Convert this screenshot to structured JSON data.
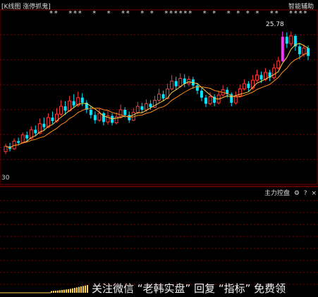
{
  "header": {
    "left_title": "[K线图  涨停抓鬼]",
    "right_label": "智能辅助"
  },
  "indicator_panel": {
    "label": "主力控盘",
    "icons": [
      "gear-icon",
      "question-icon",
      "close-icon"
    ]
  },
  "watermark": "关注微信 “老韩实盘” 回复 “指标” 免费领",
  "colors": {
    "up": "#ff3b3b",
    "down": "#00e5ff",
    "limit_up": "#ff33ff",
    "ma_short": "#ffd24a",
    "ma_long": "#ff8c1a",
    "grid": "#7a0000",
    "star": "#e6e6e6",
    "bar_volume": "#ffd24a"
  },
  "chart_data": {
    "type": "candlestick",
    "price_low_label": "30",
    "peak_label": "25.78",
    "ylim": [
      10,
      27
    ],
    "candles": [
      {
        "o": 12.0,
        "c": 12.6,
        "h": 12.9,
        "l": 11.7
      },
      {
        "o": 12.6,
        "c": 12.3,
        "h": 13.0,
        "l": 12.0
      },
      {
        "o": 12.3,
        "c": 13.2,
        "h": 13.5,
        "l": 12.2
      },
      {
        "o": 13.2,
        "c": 13.0,
        "h": 13.6,
        "l": 12.7
      },
      {
        "o": 13.0,
        "c": 13.9,
        "h": 14.2,
        "l": 12.9
      },
      {
        "o": 13.9,
        "c": 13.5,
        "h": 14.3,
        "l": 13.2
      },
      {
        "o": 13.5,
        "c": 14.5,
        "h": 14.9,
        "l": 13.4
      },
      {
        "o": 14.5,
        "c": 14.1,
        "h": 15.0,
        "l": 13.8
      },
      {
        "o": 14.1,
        "c": 15.2,
        "h": 15.8,
        "l": 14.0
      },
      {
        "o": 15.2,
        "c": 14.8,
        "h": 15.9,
        "l": 14.5
      },
      {
        "o": 14.8,
        "c": 15.9,
        "h": 16.4,
        "l": 14.7
      },
      {
        "o": 15.9,
        "c": 15.5,
        "h": 16.6,
        "l": 15.2
      },
      {
        "o": 15.5,
        "c": 16.3,
        "h": 17.0,
        "l": 15.3
      },
      {
        "o": 16.3,
        "c": 17.2,
        "h": 17.9,
        "l": 16.1
      },
      {
        "o": 17.2,
        "c": 16.7,
        "h": 17.8,
        "l": 16.2
      },
      {
        "o": 16.7,
        "c": 17.8,
        "h": 18.4,
        "l": 16.6
      },
      {
        "o": 17.8,
        "c": 17.3,
        "h": 18.6,
        "l": 17.0
      },
      {
        "o": 17.3,
        "c": 18.2,
        "h": 18.9,
        "l": 17.1
      },
      {
        "o": 18.2,
        "c": 17.6,
        "h": 18.7,
        "l": 17.2
      },
      {
        "o": 17.6,
        "c": 16.8,
        "h": 17.9,
        "l": 16.4
      },
      {
        "o": 16.8,
        "c": 16.2,
        "h": 17.2,
        "l": 15.8
      },
      {
        "o": 16.2,
        "c": 15.6,
        "h": 16.6,
        "l": 15.2
      },
      {
        "o": 15.6,
        "c": 16.4,
        "h": 16.9,
        "l": 15.4
      },
      {
        "o": 16.4,
        "c": 15.4,
        "h": 16.6,
        "l": 15.0
      },
      {
        "o": 15.4,
        "c": 16.1,
        "h": 16.7,
        "l": 15.1
      },
      {
        "o": 16.1,
        "c": 15.3,
        "h": 16.4,
        "l": 15.0
      },
      {
        "o": 15.3,
        "c": 16.0,
        "h": 16.5,
        "l": 15.1
      },
      {
        "o": 16.0,
        "c": 16.8,
        "h": 17.4,
        "l": 15.8
      },
      {
        "o": 16.8,
        "c": 16.2,
        "h": 17.1,
        "l": 15.9
      },
      {
        "o": 16.2,
        "c": 15.6,
        "h": 16.6,
        "l": 15.3
      },
      {
        "o": 15.6,
        "c": 16.5,
        "h": 17.0,
        "l": 15.5
      },
      {
        "o": 16.5,
        "c": 17.2,
        "h": 17.7,
        "l": 16.3
      },
      {
        "o": 17.2,
        "c": 16.8,
        "h": 17.6,
        "l": 16.4
      },
      {
        "o": 16.8,
        "c": 17.5,
        "h": 18.0,
        "l": 16.6
      },
      {
        "o": 17.5,
        "c": 17.1,
        "h": 17.9,
        "l": 16.8
      },
      {
        "o": 17.1,
        "c": 17.9,
        "h": 18.4,
        "l": 17.0
      },
      {
        "o": 17.9,
        "c": 18.6,
        "h": 19.2,
        "l": 17.7
      },
      {
        "o": 18.6,
        "c": 18.1,
        "h": 19.0,
        "l": 17.8
      },
      {
        "o": 18.1,
        "c": 19.2,
        "h": 19.8,
        "l": 18.0
      },
      {
        "o": 19.2,
        "c": 20.1,
        "h": 20.8,
        "l": 19.0
      },
      {
        "o": 20.1,
        "c": 19.5,
        "h": 20.6,
        "l": 19.1
      },
      {
        "o": 19.5,
        "c": 20.4,
        "h": 21.0,
        "l": 19.3
      },
      {
        "o": 20.4,
        "c": 19.8,
        "h": 20.9,
        "l": 19.4
      },
      {
        "o": 19.8,
        "c": 20.3,
        "h": 20.7,
        "l": 19.5
      },
      {
        "o": 20.3,
        "c": 19.6,
        "h": 20.6,
        "l": 19.2
      },
      {
        "o": 19.6,
        "c": 19.0,
        "h": 19.9,
        "l": 18.6
      },
      {
        "o": 19.0,
        "c": 18.2,
        "h": 19.3,
        "l": 17.8
      },
      {
        "o": 18.2,
        "c": 17.5,
        "h": 18.5,
        "l": 17.1
      },
      {
        "o": 17.5,
        "c": 18.3,
        "h": 18.8,
        "l": 17.3
      },
      {
        "o": 18.3,
        "c": 17.6,
        "h": 18.6,
        "l": 17.2
      },
      {
        "o": 17.6,
        "c": 18.5,
        "h": 19.0,
        "l": 17.4
      },
      {
        "o": 18.5,
        "c": 19.1,
        "h": 19.6,
        "l": 18.3
      },
      {
        "o": 19.1,
        "c": 18.6,
        "h": 19.4,
        "l": 18.2
      },
      {
        "o": 18.6,
        "c": 17.6,
        "h": 18.8,
        "l": 17.2
      },
      {
        "o": 17.6,
        "c": 18.4,
        "h": 18.9,
        "l": 17.4
      },
      {
        "o": 18.4,
        "c": 19.2,
        "h": 19.7,
        "l": 18.2
      },
      {
        "o": 19.2,
        "c": 19.8,
        "h": 20.3,
        "l": 19.0
      },
      {
        "o": 19.8,
        "c": 19.3,
        "h": 20.1,
        "l": 18.9
      },
      {
        "o": 19.3,
        "c": 20.2,
        "h": 20.8,
        "l": 19.1
      },
      {
        "o": 20.2,
        "c": 20.8,
        "h": 21.4,
        "l": 20.0
      },
      {
        "o": 20.8,
        "c": 20.3,
        "h": 21.2,
        "l": 19.9
      },
      {
        "o": 20.3,
        "c": 21.1,
        "h": 21.6,
        "l": 20.1
      },
      {
        "o": 21.1,
        "c": 20.5,
        "h": 21.4,
        "l": 20.1
      },
      {
        "o": 20.5,
        "c": 21.6,
        "h": 22.1,
        "l": 20.3
      },
      {
        "o": 21.6,
        "c": 22.4,
        "h": 22.9,
        "l": 21.4
      },
      {
        "o": 22.4,
        "c": 25.2,
        "h": 25.8,
        "l": 22.3
      },
      {
        "o": 25.2,
        "c": 24.4,
        "h": 25.7,
        "l": 23.9
      },
      {
        "o": 24.4,
        "c": 25.3,
        "h": 25.8,
        "l": 24.1
      },
      {
        "o": 25.3,
        "c": 24.1,
        "h": 25.5,
        "l": 23.6
      },
      {
        "o": 24.1,
        "c": 23.2,
        "h": 24.4,
        "l": 22.6
      },
      {
        "o": 23.2,
        "c": 23.9,
        "h": 24.3,
        "l": 22.9
      },
      {
        "o": 23.9,
        "c": 23.0,
        "h": 24.2,
        "l": 22.5
      }
    ],
    "limit_up_index": 65,
    "star_rows": "**  ***  *  *  **  * *  ******  * *  * * * *  **  ****",
    "volume_bars": [
      0.05,
      0.08,
      0.1,
      0.14,
      0.18,
      0.22,
      0.26,
      0.3,
      0.34,
      0.4,
      0.48,
      0.55,
      0.62,
      0.7,
      0.78,
      0.85,
      0.92,
      1.0
    ]
  }
}
